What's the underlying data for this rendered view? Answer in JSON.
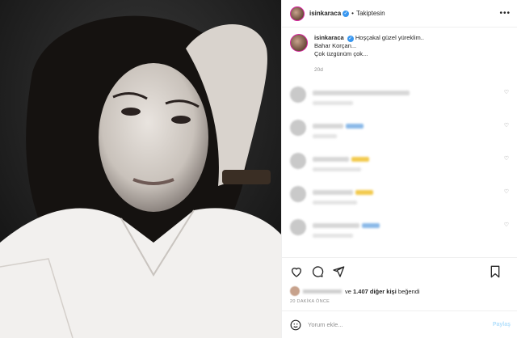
{
  "header": {
    "username": "isinkaraca",
    "verified_badge": "✓",
    "separator": "•",
    "follow_status": "Takiptesin",
    "more_icon": "more-horizontal-icon"
  },
  "caption": {
    "username": "isinkaraca",
    "lines": [
      "Hoşçakal güzel yüreklim..",
      "Bahar Korçan...",
      "Çok üzgünüm çok..."
    ],
    "time": "20d"
  },
  "comments": [
    {
      "name": "redacted",
      "emoji": false
    },
    {
      "name": "redacted",
      "emoji": true,
      "emoji_color": "#8ab9e8"
    },
    {
      "name": "redacted",
      "emoji": true,
      "emoji_color": "#f2c94c"
    },
    {
      "name": "redacted",
      "emoji": true,
      "emoji_color": "#f2c94c"
    },
    {
      "name": "redacted",
      "emoji": true,
      "emoji_color": "#8ab9e8"
    }
  ],
  "actions": {
    "like_icon": "heart-icon",
    "comment_icon": "comment-icon",
    "share_icon": "send-icon",
    "save_icon": "bookmark-icon"
  },
  "likes": {
    "connector": "ve",
    "count_text": "1.407 diğer kişi",
    "suffix": "beğendi"
  },
  "time_ago": "20 DAKİKA ÖNCE",
  "add_comment": {
    "placeholder": "Yorum ekle...",
    "post_label": "Paylaş",
    "emoji_icon": "smiley-icon"
  },
  "colors": {
    "accent": "#3897f0",
    "text": "#262626",
    "muted": "#8e8e8e",
    "post_disabled": "#b2dffc"
  }
}
